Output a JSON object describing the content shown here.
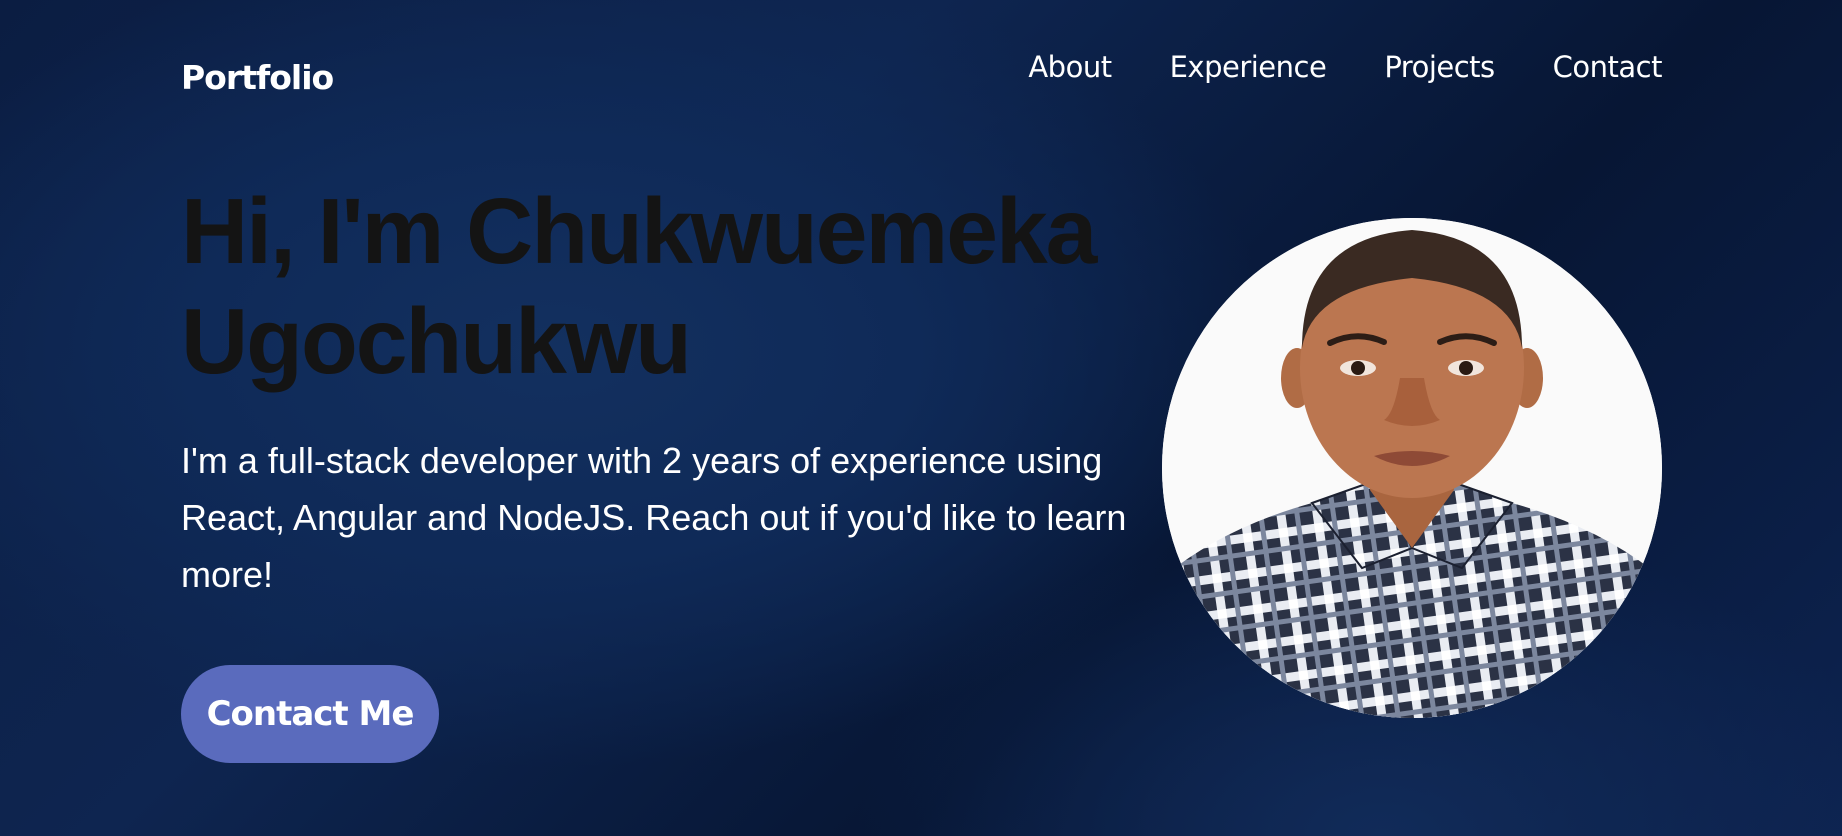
{
  "header": {
    "logo": "Portfolio",
    "nav": [
      {
        "label": "About"
      },
      {
        "label": "Experience"
      },
      {
        "label": "Projects"
      },
      {
        "label": "Contact"
      }
    ]
  },
  "hero": {
    "title": "Hi, I'm Chukwuemeka Ugochukwu",
    "description": "I'm a full-stack developer with 2 years of experience using React, Angular and NodeJS. Reach out if you'd like to learn more!",
    "cta_label": "Contact Me"
  },
  "colors": {
    "background": "#0e2550",
    "button": "#5a6bbd",
    "title_text": "#141414"
  },
  "icons": {
    "avatar": "profile-photo"
  }
}
